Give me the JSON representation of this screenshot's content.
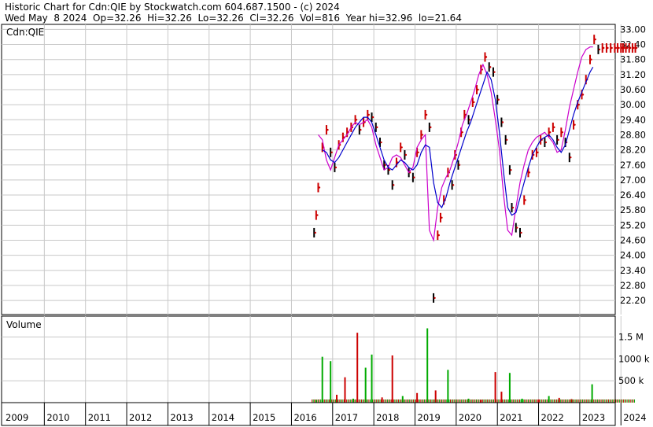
{
  "header": {
    "title": "Historic Chart for Cdn:QIE by Stockwatch.com 604.687.1500 - (c) 2024",
    "quote": "Wed May  8 2024  Op=32.26  Hi=32.26  Lo=32.26  Cl=32.26  Vol=816  Year hi=32.96  lo=21.64"
  },
  "colors": {
    "grid": "#c8c8c8",
    "price_up": "#cc0000",
    "price_down": "#000000",
    "ma_short": "#cc00cc",
    "ma_long": "#0000cc",
    "vol_up": "#00aa00",
    "vol_down": "#cc0000"
  },
  "chart_data": [
    {
      "type": "line",
      "panel": "price",
      "symbol_label": "Cdn:QIE",
      "ylim": [
        21.64,
        33.2
      ],
      "y_ticks": [
        "33.00",
        "32.40",
        "31.80",
        "31.20",
        "30.60",
        "30.00",
        "29.40",
        "28.80",
        "28.20",
        "27.60",
        "27.00",
        "26.40",
        "25.80",
        "25.20",
        "24.60",
        "24.00",
        "23.40",
        "22.80",
        "22.20"
      ],
      "x_ticks": [
        "2009",
        "2010",
        "2011",
        "2012",
        "2013",
        "2014",
        "2015",
        "2016",
        "2017",
        "2018",
        "2019",
        "2020",
        "2021",
        "2022",
        "2023",
        "2024"
      ],
      "grid": true,
      "series": [
        {
          "role": "price",
          "x": [
            2016.55,
            2016.6,
            2016.65,
            2016.75,
            2016.85,
            2016.95,
            2017.05,
            2017.15,
            2017.25,
            2017.35,
            2017.45,
            2017.55,
            2017.65,
            2017.75,
            2017.85,
            2017.95,
            2018.05,
            2018.15,
            2018.25,
            2018.35,
            2018.45,
            2018.55,
            2018.65,
            2018.75,
            2018.85,
            2018.95,
            2019.05,
            2019.15,
            2019.25,
            2019.35,
            2019.45,
            2019.55,
            2019.62,
            2019.7,
            2019.8,
            2019.9,
            2019.97,
            2020.05,
            2020.12,
            2020.2,
            2020.3,
            2020.4,
            2020.5,
            2020.6,
            2020.7,
            2020.8,
            2020.9,
            2021.0,
            2021.1,
            2021.2,
            2021.3,
            2021.35,
            2021.45,
            2021.55,
            2021.65,
            2021.75,
            2021.85,
            2021.95,
            2022.05,
            2022.15,
            2022.25,
            2022.35,
            2022.45,
            2022.55,
            2022.65,
            2022.75,
            2022.85,
            2022.95,
            2023.05,
            2023.15,
            2023.25,
            2023.35,
            2023.45,
            2023.55,
            2023.65,
            2023.75,
            2023.85,
            2023.92,
            2024.0,
            2024.05,
            2024.12,
            2024.2,
            2024.28,
            2024.35
          ],
          "y": [
            24.9,
            25.6,
            26.7,
            28.3,
            29.0,
            28.1,
            27.5,
            28.4,
            28.7,
            28.9,
            29.1,
            29.4,
            29.0,
            29.3,
            29.6,
            29.5,
            29.1,
            28.5,
            27.6,
            27.4,
            26.8,
            27.7,
            28.3,
            28.0,
            27.3,
            27.1,
            28.1,
            28.8,
            29.6,
            29.1,
            22.3,
            24.8,
            25.5,
            26.2,
            27.3,
            26.8,
            28.0,
            27.6,
            28.9,
            29.6,
            29.4,
            30.1,
            30.6,
            31.4,
            31.9,
            31.5,
            31.3,
            30.2,
            29.3,
            28.6,
            27.4,
            25.9,
            25.1,
            24.9,
            26.2,
            27.3,
            28.0,
            28.1,
            28.6,
            28.5,
            28.9,
            29.1,
            28.6,
            28.9,
            28.5,
            27.9,
            29.2,
            30.0,
            30.4,
            31.0,
            31.8,
            32.6,
            32.2,
            32.26,
            32.26,
            32.26,
            32.26,
            32.26,
            32.26,
            32.26,
            32.26,
            32.26,
            32.26,
            32.26
          ]
        },
        {
          "name": "",
          "role": "ma_short",
          "x": [
            2016.65,
            2016.75,
            2016.85,
            2016.95,
            2017.05,
            2017.15,
            2017.25,
            2017.35,
            2017.45,
            2017.55,
            2017.65,
            2017.75,
            2017.85,
            2017.95,
            2018.05,
            2018.15,
            2018.25,
            2018.35,
            2018.45,
            2018.55,
            2018.65,
            2018.75,
            2018.85,
            2018.95,
            2019.05,
            2019.15,
            2019.25,
            2019.35,
            2019.45,
            2019.55,
            2019.65,
            2019.75,
            2019.85,
            2019.95,
            2020.05,
            2020.15,
            2020.25,
            2020.35,
            2020.45,
            2020.55,
            2020.65,
            2020.75,
            2020.85,
            2020.95,
            2021.05,
            2021.15,
            2021.25,
            2021.35,
            2021.45,
            2021.55,
            2021.65,
            2021.75,
            2021.85,
            2021.95,
            2022.05,
            2022.15,
            2022.25,
            2022.35,
            2022.45,
            2022.55,
            2022.65,
            2022.75,
            2022.85,
            2022.95,
            2023.05,
            2023.15,
            2023.25,
            2023.32
          ],
          "y": [
            28.8,
            28.6,
            27.8,
            27.4,
            27.9,
            28.4,
            28.6,
            28.8,
            29.1,
            29.3,
            29.2,
            29.3,
            29.4,
            29.1,
            28.4,
            27.9,
            27.4,
            27.5,
            27.9,
            28.0,
            27.9,
            27.6,
            27.3,
            27.5,
            28.3,
            28.6,
            28.8,
            25.0,
            24.6,
            25.9,
            26.7,
            27.1,
            27.4,
            27.9,
            28.5,
            29.2,
            29.6,
            30.1,
            30.6,
            31.2,
            31.6,
            31.2,
            30.5,
            29.4,
            28.2,
            26.4,
            25.0,
            24.8,
            25.9,
            26.9,
            27.6,
            28.2,
            28.5,
            28.7,
            28.8,
            28.9,
            28.7,
            28.5,
            28.1,
            28.2,
            29.0,
            29.9,
            30.6,
            31.3,
            31.9,
            32.2,
            32.3,
            32.3
          ]
        },
        {
          "name": "",
          "role": "ma_long",
          "x": [
            2016.75,
            2016.85,
            2016.95,
            2017.05,
            2017.15,
            2017.25,
            2017.35,
            2017.45,
            2017.55,
            2017.65,
            2017.75,
            2017.85,
            2017.95,
            2018.05,
            2018.15,
            2018.25,
            2018.35,
            2018.45,
            2018.55,
            2018.65,
            2018.75,
            2018.85,
            2018.95,
            2019.05,
            2019.15,
            2019.25,
            2019.35,
            2019.45,
            2019.55,
            2019.65,
            2019.75,
            2019.85,
            2019.95,
            2020.05,
            2020.15,
            2020.25,
            2020.35,
            2020.45,
            2020.55,
            2020.65,
            2020.75,
            2020.85,
            2020.95,
            2021.05,
            2021.15,
            2021.25,
            2021.35,
            2021.45,
            2021.55,
            2021.65,
            2021.75,
            2021.85,
            2021.95,
            2022.05,
            2022.15,
            2022.25,
            2022.35,
            2022.45,
            2022.55,
            2022.65,
            2022.75,
            2022.85,
            2022.95,
            2023.05,
            2023.15,
            2023.25,
            2023.32
          ],
          "y": [
            28.2,
            28.1,
            27.8,
            27.7,
            27.9,
            28.2,
            28.5,
            28.8,
            29.1,
            29.3,
            29.5,
            29.5,
            29.3,
            28.8,
            28.3,
            27.8,
            27.5,
            27.4,
            27.6,
            27.8,
            27.7,
            27.5,
            27.4,
            27.6,
            28.1,
            28.4,
            28.3,
            26.9,
            26.1,
            25.9,
            26.3,
            26.9,
            27.4,
            27.9,
            28.4,
            28.9,
            29.3,
            29.8,
            30.3,
            30.8,
            31.3,
            31.0,
            30.2,
            28.9,
            27.3,
            25.9,
            25.6,
            25.7,
            26.3,
            26.9,
            27.5,
            28.0,
            28.3,
            28.6,
            28.7,
            28.8,
            28.6,
            28.3,
            28.1,
            28.4,
            29.0,
            29.6,
            30.1,
            30.5,
            30.9,
            31.3,
            31.5
          ]
        }
      ]
    },
    {
      "type": "bar",
      "panel": "volume",
      "title": "Volume",
      "y_ticks": [
        "1.5 M",
        "1000 k",
        "500 k"
      ],
      "ylim": [
        0,
        1800000
      ],
      "bars": [
        {
          "x": 2016.6,
          "value": 60000,
          "up": true
        },
        {
          "x": 2016.75,
          "value": 1050000,
          "up": true
        },
        {
          "x": 2016.95,
          "value": 950000,
          "up": true
        },
        {
          "x": 2017.1,
          "value": 180000,
          "up": false
        },
        {
          "x": 2017.3,
          "value": 580000,
          "up": false
        },
        {
          "x": 2017.5,
          "value": 90000,
          "up": true
        },
        {
          "x": 2017.6,
          "value": 1600000,
          "up": false
        },
        {
          "x": 2017.8,
          "value": 800000,
          "up": true
        },
        {
          "x": 2017.95,
          "value": 1100000,
          "up": true
        },
        {
          "x": 2018.2,
          "value": 120000,
          "up": false
        },
        {
          "x": 2018.45,
          "value": 1080000,
          "up": false
        },
        {
          "x": 2018.7,
          "value": 150000,
          "up": true
        },
        {
          "x": 2019.05,
          "value": 220000,
          "up": false
        },
        {
          "x": 2019.3,
          "value": 1700000,
          "up": true
        },
        {
          "x": 2019.5,
          "value": 280000,
          "up": false
        },
        {
          "x": 2019.8,
          "value": 750000,
          "up": true
        },
        {
          "x": 2020.3,
          "value": 90000,
          "up": true
        },
        {
          "x": 2020.6,
          "value": 60000,
          "up": false
        },
        {
          "x": 2020.95,
          "value": 700000,
          "up": false
        },
        {
          "x": 2021.1,
          "value": 250000,
          "up": false
        },
        {
          "x": 2021.3,
          "value": 680000,
          "up": true
        },
        {
          "x": 2021.6,
          "value": 90000,
          "up": true
        },
        {
          "x": 2022.0,
          "value": 70000,
          "up": false
        },
        {
          "x": 2022.25,
          "value": 150000,
          "up": true
        },
        {
          "x": 2022.5,
          "value": 110000,
          "up": false
        },
        {
          "x": 2022.8,
          "value": 80000,
          "up": false
        },
        {
          "x": 2023.3,
          "value": 420000,
          "up": true
        }
      ]
    }
  ]
}
